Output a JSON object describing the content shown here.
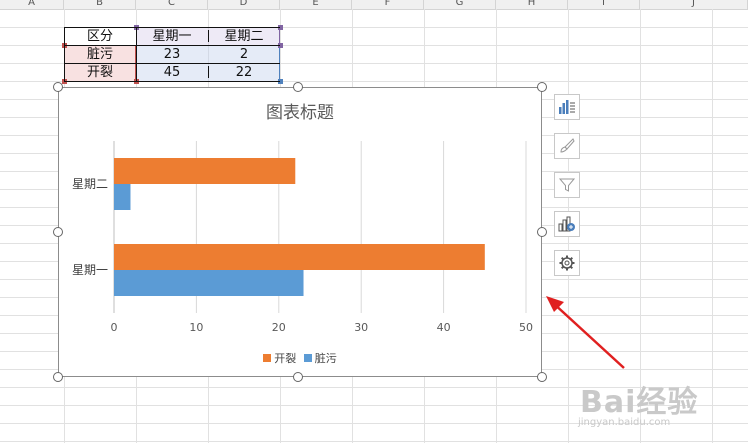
{
  "spreadsheet": {
    "columns": [
      "A",
      "B",
      "C",
      "D",
      "E",
      "F",
      "G",
      "H",
      "I",
      "J"
    ],
    "table": {
      "header": [
        "区分",
        "星期一",
        "星期二"
      ],
      "rows": [
        {
          "label": "脏污",
          "values": [
            "23",
            "2"
          ]
        },
        {
          "label": "开裂",
          "values": [
            "45",
            "22"
          ]
        }
      ]
    },
    "colors": {
      "category_range": "#c0504d",
      "header_range": "#8064a2",
      "value_range": "#4f81bd"
    }
  },
  "chart": {
    "title": "图表标题",
    "legend": [
      "开裂",
      "脏污"
    ],
    "side_buttons": [
      "chart-elements-icon",
      "chart-styles-icon",
      "chart-filters-icon",
      "chart-layout-icon",
      "chart-settings-icon"
    ]
  },
  "chart_data": {
    "type": "bar",
    "orientation": "horizontal",
    "categories": [
      "星期一",
      "星期二"
    ],
    "series": [
      {
        "name": "脏污",
        "color": "#5b9bd5",
        "values": [
          23,
          2
        ]
      },
      {
        "name": "开裂",
        "color": "#ed7d31",
        "values": [
          45,
          22
        ]
      }
    ],
    "xlim": [
      0,
      50
    ],
    "xticks": [
      "0",
      "10",
      "20",
      "30",
      "40",
      "50"
    ],
    "grid": true,
    "legend_position": "bottom"
  },
  "watermark": {
    "main": "Bai经验",
    "sub": "jingyan.baidu.com"
  }
}
